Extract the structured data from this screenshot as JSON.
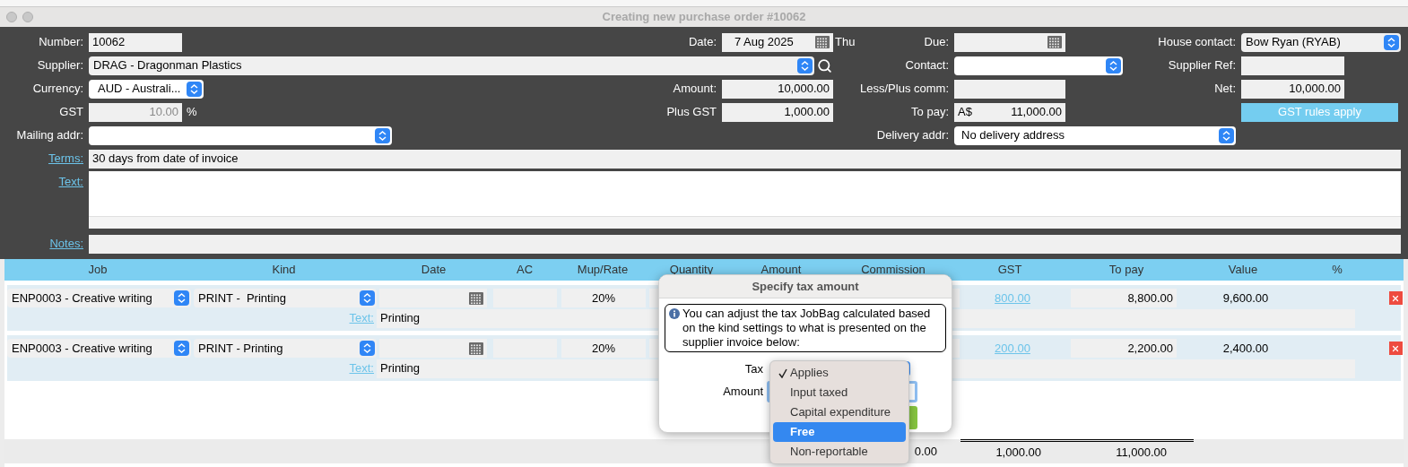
{
  "window": {
    "title": "Creating new purchase order #10062"
  },
  "form": {
    "number": {
      "label": "Number:",
      "value": "10062"
    },
    "date": {
      "label": "Date:",
      "value": "7 Aug 2025",
      "weekday": "Thu"
    },
    "due": {
      "label": "Due:"
    },
    "house_contact": {
      "label": "House contact:",
      "value": "Bow Ryan (RYAB)"
    },
    "supplier": {
      "label": "Supplier:",
      "value": "DRAG - Dragonman Plastics"
    },
    "contact": {
      "label": "Contact:"
    },
    "supplier_ref": {
      "label": "Supplier Ref:"
    },
    "currency": {
      "label": "Currency:",
      "value": "AUD - Australi..."
    },
    "amount": {
      "label": "Amount:",
      "value": "10,000.00"
    },
    "less_plus_comm": {
      "label": "Less/Plus comm:"
    },
    "net": {
      "label": "Net:",
      "value": "10,000.00"
    },
    "gst": {
      "label": "GST",
      "value": "10.00",
      "unit": "%",
      "disabled": true
    },
    "plus_gst": {
      "label": "Plus GST",
      "value": "1,000.00"
    },
    "to_pay": {
      "label": "To pay:",
      "currency": "A$",
      "value": "11,000.00"
    },
    "gst_rules_button": "GST rules apply",
    "mailing_addr": {
      "label": "Mailing addr:"
    },
    "delivery_addr": {
      "label": "Delivery addr:",
      "value": "No delivery address"
    },
    "terms": {
      "label": "Terms:",
      "value": "30 days from date of invoice"
    },
    "text": {
      "label": "Text:"
    },
    "notes": {
      "label": "Notes:"
    }
  },
  "table": {
    "columns": [
      "Job",
      "Kind",
      "Date",
      "AC",
      "Mup/Rate",
      "Quantity",
      "Amount",
      "Commission",
      "GST",
      "To pay",
      "Value",
      "%"
    ],
    "rows": [
      {
        "job": "ENP0003 - Creative writing",
        "kind": "PRINT -  Printing",
        "mup_rate": "20%",
        "gst": "800.00",
        "to_pay": "8,800.00",
        "value": "9,600.00",
        "text_label": "Text:",
        "text": "Printing"
      },
      {
        "job": "ENP0003 - Creative writing",
        "kind": "PRINT - Printing",
        "mup_rate": "20%",
        "gst": "200.00",
        "to_pay": "2,200.00",
        "value": "2,400.00",
        "text_label": "Text:",
        "text": "Printing"
      }
    ],
    "totals": {
      "commission": "0.00",
      "gst": "1,000.00",
      "to_pay": "11,000.00"
    }
  },
  "dialog": {
    "title": "Specify tax amount",
    "message": "You can adjust the tax JobBag calculated based on the kind settings to what is presented on the supplier invoice below:",
    "tax_label": "Tax",
    "amount_label": "Amount"
  },
  "menu": {
    "items": [
      {
        "label": "Applies",
        "checked": true,
        "selected": false
      },
      {
        "label": "Input taxed",
        "checked": false,
        "selected": false
      },
      {
        "label": "Capital expenditure",
        "checked": false,
        "selected": false
      },
      {
        "label": "Free",
        "checked": false,
        "selected": true
      },
      {
        "label": "Non-reportable",
        "checked": false,
        "selected": false
      }
    ]
  }
}
